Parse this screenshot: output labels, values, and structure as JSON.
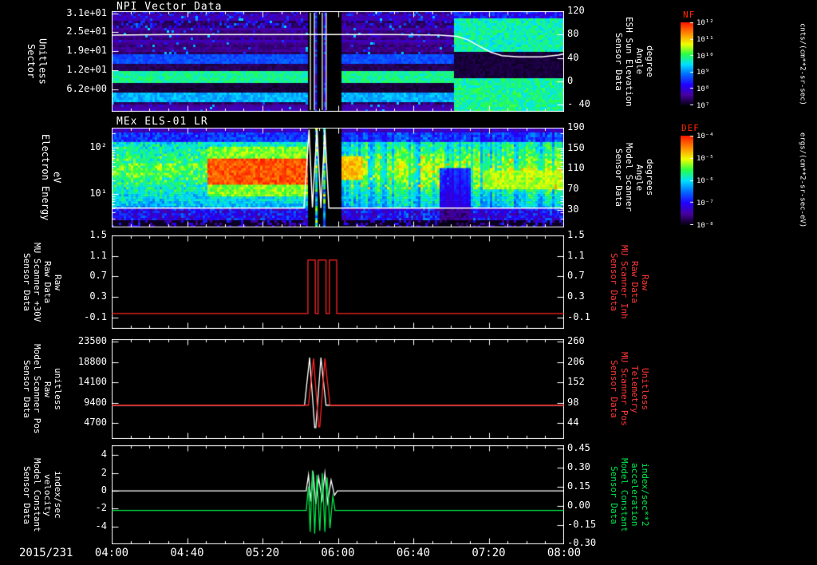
{
  "app": {
    "date_label": "2015/231",
    "background": "#000000"
  },
  "time_axis": {
    "start_hour": 4.0,
    "end_hour": 8.0,
    "tick_labels": [
      "04:00",
      "04:40",
      "05:20",
      "06:00",
      "06:40",
      "07:20",
      "08:00"
    ]
  },
  "chart_data": [
    {
      "type": "heatmap",
      "title": "NPI Vector Data",
      "ylabel": "Sector\nUnitless",
      "yticks": [
        "3.1e+01",
        "2.5e+01",
        "1.9e+01",
        "1.2e+01",
        "6.2e+00"
      ],
      "right_axis": {
        "label": "Sensor Data\nESH Sun Elevation\nAngle\ndegree",
        "color": "#ffffff",
        "ticks": [
          "120",
          "80",
          "40",
          "0",
          "- 40"
        ],
        "ylim": [
          120,
          -52
        ]
      },
      "colorbar": {
        "label": "NF",
        "label_color": "#ff2a00",
        "units": "cnts/(cm**2-sr-sec)",
        "ticks": [
          "10¹²",
          "10¹¹",
          "10¹⁰",
          "10⁹",
          "10⁸",
          "10⁷"
        ]
      },
      "data_gap_hours": [
        5.73,
        6.03
      ],
      "gap_white_lines_hours": [
        5.757,
        5.792,
        5.862,
        5.897
      ],
      "features": {
        "bright_bands": "enhanced counts in sector rows near 1.2e+01 and 6.2e+00 across the interval",
        "post_0700": "after ~07:00 bright emission in top and bottom sectors with dark middle sectors"
      },
      "overlay_line": {
        "name": "ESH sun elevation angle (deg)",
        "color": "#ffffff",
        "points": [
          [
            4.0,
            79
          ],
          [
            4.5,
            80
          ],
          [
            5.0,
            80
          ],
          [
            5.5,
            80
          ],
          [
            5.73,
            80
          ],
          [
            6.03,
            80
          ],
          [
            6.5,
            80
          ],
          [
            6.9,
            79
          ],
          [
            7.05,
            77
          ],
          [
            7.15,
            71
          ],
          [
            7.25,
            60
          ],
          [
            7.35,
            50
          ],
          [
            7.45,
            44
          ],
          [
            7.6,
            42
          ],
          [
            7.8,
            42
          ],
          [
            7.95,
            45
          ],
          [
            8.0,
            47
          ]
        ]
      }
    },
    {
      "type": "heatmap",
      "title": "MEx ELS-01 LR",
      "ylabel": "Electron Energy\neV",
      "yscale": "log",
      "yticks": [
        "10²",
        "10¹"
      ],
      "right_axis": {
        "label": "Sensor Data\nModel Scanner\nAngle\ndegrees",
        "color": "#ffffff",
        "ticks": [
          "190",
          "150",
          "110",
          "70",
          "30"
        ],
        "ylim": [
          190,
          -5
        ]
      },
      "colorbar": {
        "label": "DEF",
        "label_color": "#ff2a00",
        "units": "ergs/(cm**2-sr-sec-eV)",
        "ticks": [
          "10⁻⁴",
          "10⁻⁵",
          "10⁻⁶",
          "10⁻⁷",
          "10⁻⁸"
        ]
      },
      "data_gap_hours": [
        5.73,
        6.03
      ],
      "features": {
        "intense_band": "strong red-orange electron flux 20-60 eV from ~04:50 to ~05:43",
        "post_gap": "patchy green-yellow flux after 06:00 with a dark interval near 07:00"
      },
      "overlay_line": {
        "name": "scanner angle (deg)",
        "color": "#ffffff",
        "points": [
          [
            4.0,
            33
          ],
          [
            5.7,
            33
          ],
          [
            5.745,
            186
          ],
          [
            5.775,
            34
          ],
          [
            5.815,
            186
          ],
          [
            5.85,
            33
          ],
          [
            5.885,
            186
          ],
          [
            5.92,
            33
          ],
          [
            6.03,
            33
          ],
          [
            8.0,
            33
          ]
        ]
      }
    },
    {
      "type": "line",
      "ylabel": "Sensor Data\nMU Scanner +30V\nRaw Data\nRaw",
      "yticks": [
        "1.5",
        "1.1",
        "0.7",
        "0.3",
        "-0.1"
      ],
      "ylim": [
        1.5,
        -0.318
      ],
      "right_axis": {
        "label": "Sensor Data\nMU Scanner Inh\nRaw Data\nRaw",
        "color": "#ff3838",
        "ticks": [
          "1.5",
          "1.1",
          "0.7",
          "0.3",
          "-0.1"
        ]
      },
      "series": [
        {
          "name": "MU scanner +30V raw",
          "color": "#ff2222",
          "points": [
            [
              4.0,
              -0.02
            ],
            [
              5.735,
              -0.02
            ],
            [
              5.735,
              1.02
            ],
            [
              5.8,
              1.02
            ],
            [
              5.8,
              -0.02
            ],
            [
              5.825,
              -0.02
            ],
            [
              5.825,
              1.02
            ],
            [
              5.895,
              1.02
            ],
            [
              5.895,
              -0.02
            ],
            [
              5.925,
              -0.02
            ],
            [
              5.925,
              1.02
            ],
            [
              5.99,
              1.02
            ],
            [
              5.99,
              -0.02
            ],
            [
              8.0,
              -0.02
            ]
          ]
        }
      ]
    },
    {
      "type": "line",
      "ylabel": "Sensor Data\nModel Scanner Pos\nRaw\nunitless",
      "yticks": [
        "23500",
        "18800",
        "14100",
        "9400",
        "4700"
      ],
      "ylim": [
        24050,
        1010
      ],
      "right_axis": {
        "label": "Sensor Data\nMU Scanner Pos\nTelemetry\nUnitless",
        "color": "#ff3838",
        "ticks": [
          "260",
          "206",
          "152",
          "98",
          "44"
        ]
      },
      "series": [
        {
          "name": "model scanner pos raw",
          "color": "#ffffff",
          "points": [
            [
              4.0,
              8800
            ],
            [
              5.705,
              8800
            ],
            [
              5.75,
              19800
            ],
            [
              5.795,
              3600
            ],
            [
              5.805,
              3600
            ],
            [
              5.85,
              19800
            ],
            [
              5.895,
              8800
            ],
            [
              8.0,
              8800
            ]
          ]
        },
        {
          "name": "MU scanner pos telemetry",
          "color": "#ff2222",
          "points": [
            [
              4.0,
              8800
            ],
            [
              5.74,
              8800
            ],
            [
              5.785,
              19600
            ],
            [
              5.83,
              3800
            ],
            [
              5.84,
              3800
            ],
            [
              5.885,
              19600
            ],
            [
              5.93,
              8800
            ],
            [
              8.0,
              8800
            ]
          ]
        }
      ]
    },
    {
      "type": "line",
      "ylabel": "Sensor Data\nModel Constant\nvelocity\nindex/sec",
      "yticks": [
        "4",
        "2",
        "0",
        "-2",
        "-4"
      ],
      "ylim": [
        5.11,
        -6.0
      ],
      "right_axis": {
        "label": "Sensor Data\nModel Constant\nacceleration\nindex/sec**2",
        "color": "#00e84a",
        "ticks": [
          "0.45",
          "0.30",
          "0.15",
          "0.00",
          "-0.15",
          "-0.30"
        ]
      },
      "series": [
        {
          "name": "model constant velocity",
          "color": "#ffffff",
          "points": [
            [
              4.0,
              0
            ],
            [
              5.72,
              0
            ],
            [
              5.74,
              1.8
            ],
            [
              5.76,
              -1.2
            ],
            [
              5.78,
              2.2
            ],
            [
              5.805,
              -1.5
            ],
            [
              5.83,
              1.5
            ],
            [
              5.86,
              -1.0
            ],
            [
              5.885,
              2.0
            ],
            [
              5.91,
              -1.3
            ],
            [
              5.94,
              1.2
            ],
            [
              5.97,
              -0.5
            ],
            [
              5.995,
              0
            ],
            [
              8.0,
              0
            ]
          ]
        },
        {
          "name": "model constant acceleration",
          "color": "#00e84a",
          "points": [
            [
              4.0,
              -2.2
            ],
            [
              5.72,
              -2.2
            ],
            [
              5.74,
              0.5
            ],
            [
              5.755,
              -4.6
            ],
            [
              5.775,
              2.3
            ],
            [
              5.795,
              -4.8
            ],
            [
              5.815,
              1.8
            ],
            [
              5.84,
              -4.5
            ],
            [
              5.862,
              2.0
            ],
            [
              5.885,
              -4.6
            ],
            [
              5.905,
              1.5
            ],
            [
              5.93,
              -4.2
            ],
            [
              5.955,
              -0.6
            ],
            [
              5.975,
              -2.2
            ],
            [
              8.0,
              -2.2
            ]
          ]
        }
      ]
    }
  ]
}
